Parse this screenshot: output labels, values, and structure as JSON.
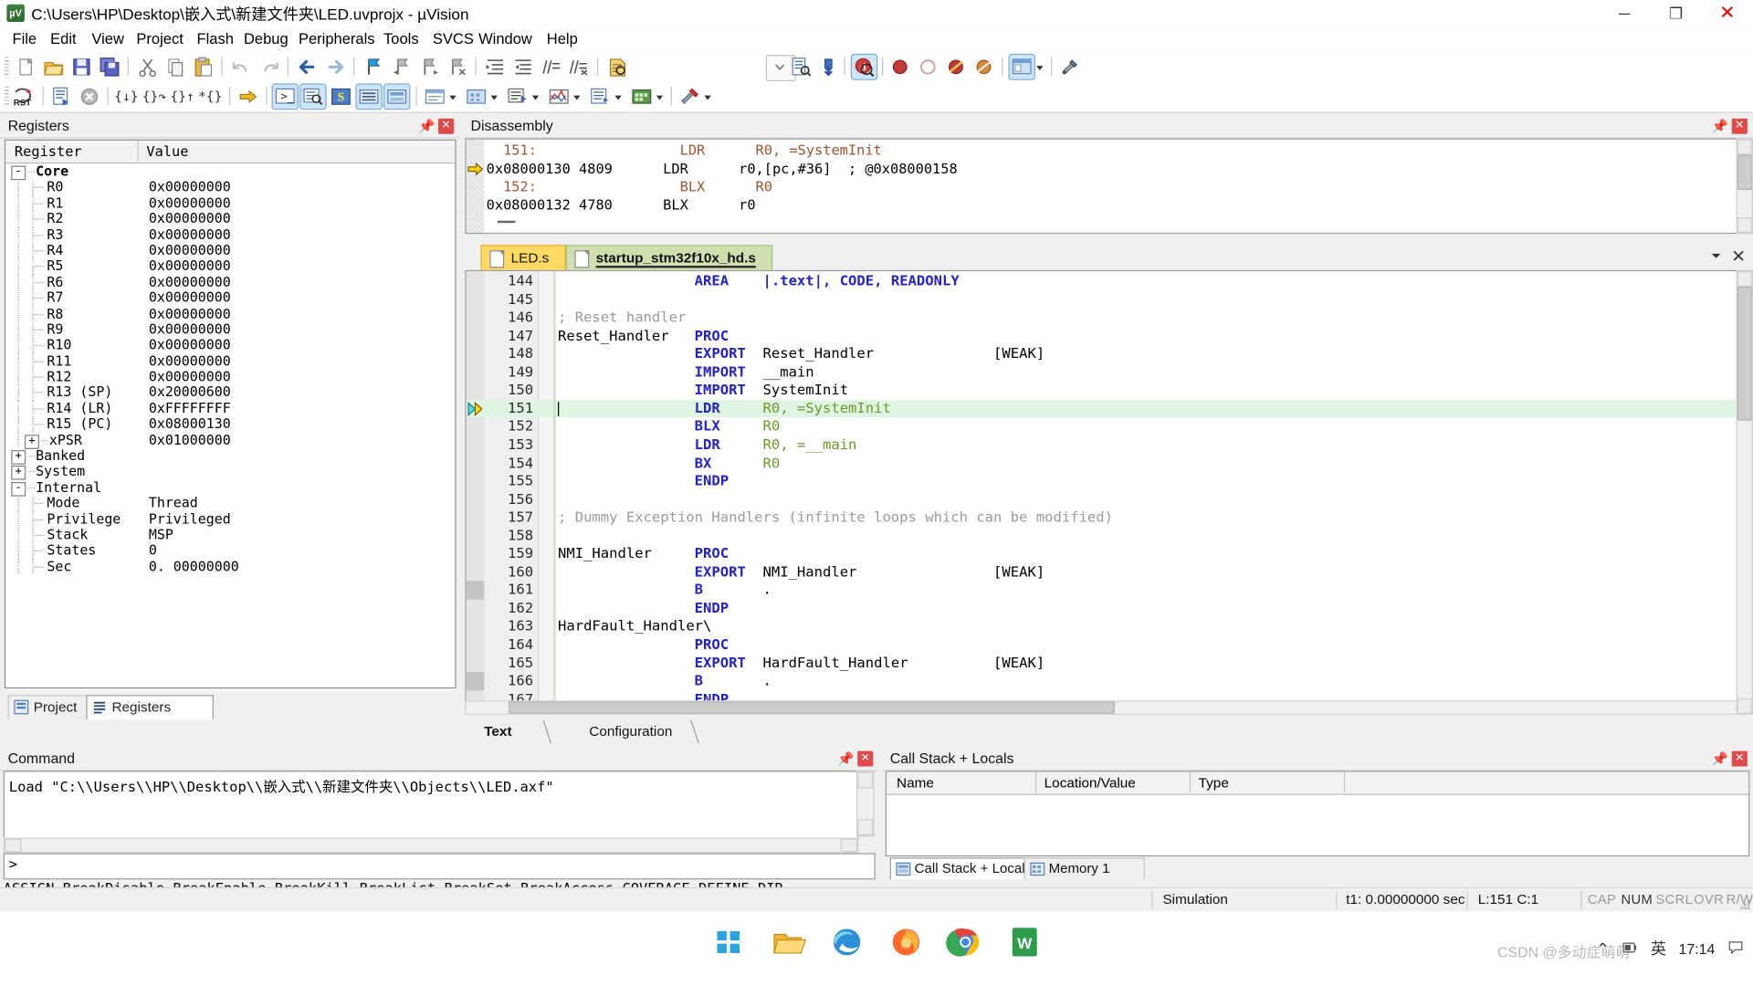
{
  "window": {
    "title": "C:\\Users\\HP\\Desktop\\嵌入式\\新建文件夹\\LED.uvprojx - µVision",
    "app_icon": "uvision-icon",
    "minimize": "─",
    "maximize": "❐",
    "close": "✕"
  },
  "menu": [
    {
      "label": "File"
    },
    {
      "label": "Edit"
    },
    {
      "label": "View"
    },
    {
      "label": "Project"
    },
    {
      "label": "Flash"
    },
    {
      "label": "Debug"
    },
    {
      "label": "Peripherals"
    },
    {
      "label": "Tools"
    },
    {
      "label": "SVCS"
    },
    {
      "label": "Window"
    },
    {
      "label": "Help"
    }
  ],
  "toolbar_row1": [
    {
      "name": "new-file-icon"
    },
    {
      "name": "open-file-icon"
    },
    {
      "name": "save-icon"
    },
    {
      "name": "save-all-icon"
    },
    {
      "name": "cut-icon"
    },
    {
      "name": "copy-icon"
    },
    {
      "name": "paste-icon"
    },
    {
      "name": "undo-icon"
    },
    {
      "name": "redo-icon"
    },
    {
      "name": "back-icon"
    },
    {
      "name": "forward-icon"
    },
    {
      "name": "bookmark-toggle-icon"
    },
    {
      "name": "bookmark-prev-icon"
    },
    {
      "name": "bookmark-next-icon"
    },
    {
      "name": "bookmark-clear-icon"
    },
    {
      "name": "indent-icon"
    },
    {
      "name": "outdent-icon"
    },
    {
      "name": "comment-icon"
    },
    {
      "name": "uncomment-icon"
    },
    {
      "name": "find-in-files-icon"
    },
    {
      "name": "find-combo-dropdown"
    },
    {
      "name": "incremental-find-icon"
    },
    {
      "name": "bookmark-goto-icon"
    },
    {
      "name": "debug-session-icon"
    },
    {
      "name": "insert-breakpoint-icon"
    },
    {
      "name": "disable-breakpoint-icon"
    },
    {
      "name": "kill-all-breakpoints-icon"
    },
    {
      "name": "disable-all-breakpoints-icon"
    },
    {
      "name": "manage-windows-icon"
    },
    {
      "name": "manage-windows-dropdown"
    },
    {
      "name": "configure-tools-icon"
    }
  ],
  "toolbar_row2": [
    {
      "name": "reset-cpu-icon"
    },
    {
      "name": "run-icon"
    },
    {
      "name": "stop-icon"
    },
    {
      "name": "step-icon"
    },
    {
      "name": "step-over-icon"
    },
    {
      "name": "step-out-icon"
    },
    {
      "name": "run-to-cursor-icon"
    },
    {
      "name": "show-next-statement-icon"
    },
    {
      "name": "command-window-icon"
    },
    {
      "name": "disassembly-window-icon"
    },
    {
      "name": "symbols-window-icon"
    },
    {
      "name": "registers-window-icon"
    },
    {
      "name": "call-stack-window-icon"
    },
    {
      "name": "watch-windows-icon"
    },
    {
      "name": "watch-dropdown"
    },
    {
      "name": "memory-windows-icon"
    },
    {
      "name": "memory-dropdown"
    },
    {
      "name": "serial-windows-icon"
    },
    {
      "name": "serial-dropdown"
    },
    {
      "name": "analysis-windows-icon"
    },
    {
      "name": "analysis-dropdown"
    },
    {
      "name": "trace-windows-icon"
    },
    {
      "name": "trace-dropdown"
    },
    {
      "name": "system-viewer-icon"
    },
    {
      "name": "system-viewer-dropdown"
    },
    {
      "name": "toolbox-icon"
    },
    {
      "name": "toolbox-dropdown"
    }
  ],
  "registers_pane": {
    "title": "Registers",
    "pin_icon": "pin-icon",
    "close_icon": "close-icon",
    "columns": [
      "Register",
      "Value"
    ],
    "rows": [
      {
        "indent": 0,
        "toggle": "-",
        "name": "Core",
        "value": "",
        "bold": true
      },
      {
        "indent": 2,
        "toggle": "",
        "name": "R0",
        "value": "0x00000000"
      },
      {
        "indent": 2,
        "toggle": "",
        "name": "R1",
        "value": "0x00000000"
      },
      {
        "indent": 2,
        "toggle": "",
        "name": "R2",
        "value": "0x00000000"
      },
      {
        "indent": 2,
        "toggle": "",
        "name": "R3",
        "value": "0x00000000"
      },
      {
        "indent": 2,
        "toggle": "",
        "name": "R4",
        "value": "0x00000000"
      },
      {
        "indent": 2,
        "toggle": "",
        "name": "R5",
        "value": "0x00000000"
      },
      {
        "indent": 2,
        "toggle": "",
        "name": "R6",
        "value": "0x00000000"
      },
      {
        "indent": 2,
        "toggle": "",
        "name": "R7",
        "value": "0x00000000"
      },
      {
        "indent": 2,
        "toggle": "",
        "name": "R8",
        "value": "0x00000000"
      },
      {
        "indent": 2,
        "toggle": "",
        "name": "R9",
        "value": "0x00000000"
      },
      {
        "indent": 2,
        "toggle": "",
        "name": "R10",
        "value": "0x00000000"
      },
      {
        "indent": 2,
        "toggle": "",
        "name": "R11",
        "value": "0x00000000"
      },
      {
        "indent": 2,
        "toggle": "",
        "name": "R12",
        "value": "0x00000000"
      },
      {
        "indent": 2,
        "toggle": "",
        "name": "R13 (SP)",
        "value": "0x20000600"
      },
      {
        "indent": 2,
        "toggle": "",
        "name": "R14 (LR)",
        "value": "0xFFFFFFFF"
      },
      {
        "indent": 2,
        "toggle": "",
        "name": "R15 (PC)",
        "value": "0x08000130"
      },
      {
        "indent": 1,
        "toggle": "+",
        "name": "xPSR",
        "value": "0x01000000"
      },
      {
        "indent": 0,
        "toggle": "+",
        "name": "Banked",
        "value": ""
      },
      {
        "indent": 0,
        "toggle": "+",
        "name": "System",
        "value": ""
      },
      {
        "indent": 0,
        "toggle": "-",
        "name": "Internal",
        "value": ""
      },
      {
        "indent": 2,
        "toggle": "",
        "name": "Mode",
        "value": "Thread"
      },
      {
        "indent": 2,
        "toggle": "",
        "name": "Privilege",
        "value": "Privileged"
      },
      {
        "indent": 2,
        "toggle": "",
        "name": "Stack",
        "value": "MSP"
      },
      {
        "indent": 2,
        "toggle": "",
        "name": "States",
        "value": "0"
      },
      {
        "indent": 2,
        "toggle": "",
        "name": "Sec",
        "value": "0. 00000000"
      }
    ],
    "bottom_tabs": [
      {
        "label": "Project",
        "icon": "project-icon",
        "active": false
      },
      {
        "label": "Registers",
        "icon": "registers-icon",
        "active": true
      }
    ]
  },
  "disassembly_pane": {
    "title": "Disassembly",
    "pin_icon": "pin-icon",
    "close_icon": "close-icon",
    "lines": [
      {
        "kind": "src",
        "text": "  151:                 LDR      R0, =SystemInit ",
        "pc": false
      },
      {
        "kind": "asm",
        "text": "0x08000130 4809      LDR      r0,[pc,#36]  ; @0x08000158",
        "pc": true
      },
      {
        "kind": "src",
        "text": "  152:                 BLX      R0 ",
        "pc": false
      },
      {
        "kind": "asm",
        "text": "0x08000132 4780      BLX      r0",
        "pc": false
      }
    ]
  },
  "editor": {
    "tabs": [
      {
        "label": "LED.s",
        "active": false,
        "icon": "file-icon"
      },
      {
        "label": "startup_stm32f10x_hd.s",
        "active": true,
        "icon": "file-icon"
      }
    ],
    "bottom_tabs": [
      {
        "label": "Text Editor",
        "active": true
      },
      {
        "label": "Configuration Wizard",
        "active": false
      }
    ],
    "lines": [
      {
        "num": "144",
        "hl": false,
        "marker": "",
        "spans": [
          {
            "t": "                ",
            "c": "plain"
          },
          {
            "t": "AREA",
            "c": "kw"
          },
          {
            "t": "    ",
            "c": "plain"
          },
          {
            "t": "|.text|,",
            "c": "kw"
          },
          {
            "t": " ",
            "c": "plain"
          },
          {
            "t": "CODE,",
            "c": "kw"
          },
          {
            "t": " ",
            "c": "plain"
          },
          {
            "t": "READONLY",
            "c": "kw"
          }
        ]
      },
      {
        "num": "145",
        "hl": false,
        "marker": "",
        "spans": []
      },
      {
        "num": "146",
        "hl": false,
        "marker": "",
        "spans": [
          {
            "t": "; Reset handler",
            "c": "cmt"
          }
        ]
      },
      {
        "num": "147",
        "hl": false,
        "marker": "",
        "spans": [
          {
            "t": "Reset_Handler   ",
            "c": "plain"
          },
          {
            "t": "PROC",
            "c": "kw"
          }
        ]
      },
      {
        "num": "148",
        "hl": false,
        "marker": "",
        "spans": [
          {
            "t": "                ",
            "c": "plain"
          },
          {
            "t": "EXPORT",
            "c": "kw"
          },
          {
            "t": "  Reset_Handler              [WEAK]",
            "c": "plain"
          }
        ]
      },
      {
        "num": "149",
        "hl": false,
        "marker": "",
        "spans": [
          {
            "t": "                ",
            "c": "plain"
          },
          {
            "t": "IMPORT",
            "c": "kw"
          },
          {
            "t": "  __main",
            "c": "plain"
          }
        ]
      },
      {
        "num": "150",
        "hl": false,
        "marker": "",
        "spans": [
          {
            "t": "                ",
            "c": "plain"
          },
          {
            "t": "IMPORT",
            "c": "kw"
          },
          {
            "t": "  SystemInit",
            "c": "plain"
          }
        ]
      },
      {
        "num": "151",
        "hl": true,
        "marker": "pc-arrows",
        "spans": [
          {
            "t": "                ",
            "c": "plain"
          },
          {
            "t": "LDR",
            "c": "kw"
          },
          {
            "t": "     ",
            "c": "plain"
          },
          {
            "t": "R0, =SystemInit",
            "c": "reg6"
          }
        ]
      },
      {
        "num": "152",
        "hl": false,
        "marker": "",
        "spans": [
          {
            "t": "                ",
            "c": "plain"
          },
          {
            "t": "BLX",
            "c": "kw"
          },
          {
            "t": "     ",
            "c": "plain"
          },
          {
            "t": "R0",
            "c": "reg6"
          }
        ]
      },
      {
        "num": "153",
        "hl": false,
        "marker": "",
        "spans": [
          {
            "t": "                ",
            "c": "plain"
          },
          {
            "t": "LDR",
            "c": "kw"
          },
          {
            "t": "     ",
            "c": "plain"
          },
          {
            "t": "R0, =__main",
            "c": "reg6"
          }
        ]
      },
      {
        "num": "154",
        "hl": false,
        "marker": "",
        "spans": [
          {
            "t": "                ",
            "c": "plain"
          },
          {
            "t": "BX",
            "c": "kw"
          },
          {
            "t": "      ",
            "c": "plain"
          },
          {
            "t": "R0",
            "c": "reg6"
          }
        ]
      },
      {
        "num": "155",
        "hl": false,
        "marker": "",
        "spans": [
          {
            "t": "                ",
            "c": "plain"
          },
          {
            "t": "ENDP",
            "c": "kw"
          }
        ]
      },
      {
        "num": "156",
        "hl": false,
        "marker": "",
        "spans": []
      },
      {
        "num": "157",
        "hl": false,
        "marker": "",
        "spans": [
          {
            "t": "; Dummy Exception Handlers (infinite loops which can be modified)",
            "c": "cmt"
          }
        ]
      },
      {
        "num": "158",
        "hl": false,
        "marker": "",
        "spans": []
      },
      {
        "num": "159",
        "hl": false,
        "marker": "",
        "spans": [
          {
            "t": "NMI_Handler     ",
            "c": "plain"
          },
          {
            "t": "PROC",
            "c": "kw"
          }
        ]
      },
      {
        "num": "160",
        "hl": false,
        "marker": "",
        "spans": [
          {
            "t": "                ",
            "c": "plain"
          },
          {
            "t": "EXPORT",
            "c": "kw"
          },
          {
            "t": "  NMI_Handler                [WEAK]",
            "c": "plain"
          }
        ]
      },
      {
        "num": "161",
        "hl": false,
        "marker": "bar",
        "spans": [
          {
            "t": "                ",
            "c": "plain"
          },
          {
            "t": "B",
            "c": "kw"
          },
          {
            "t": "       .",
            "c": "plain"
          }
        ]
      },
      {
        "num": "162",
        "hl": false,
        "marker": "",
        "spans": [
          {
            "t": "                ",
            "c": "plain"
          },
          {
            "t": "ENDP",
            "c": "kw"
          }
        ]
      },
      {
        "num": "163",
        "hl": false,
        "marker": "",
        "spans": [
          {
            "t": "HardFault_Handler\\",
            "c": "plain"
          }
        ]
      },
      {
        "num": "164",
        "hl": false,
        "marker": "",
        "spans": [
          {
            "t": "                ",
            "c": "plain"
          },
          {
            "t": "PROC",
            "c": "kw"
          }
        ]
      },
      {
        "num": "165",
        "hl": false,
        "marker": "",
        "spans": [
          {
            "t": "                ",
            "c": "plain"
          },
          {
            "t": "EXPORT",
            "c": "kw"
          },
          {
            "t": "  HardFault_Handler          [WEAK]",
            "c": "plain"
          }
        ]
      },
      {
        "num": "166",
        "hl": false,
        "marker": "bar",
        "spans": [
          {
            "t": "                ",
            "c": "plain"
          },
          {
            "t": "B",
            "c": "kw"
          },
          {
            "t": "       .",
            "c": "plain"
          }
        ]
      },
      {
        "num": "167",
        "hl": false,
        "marker": "",
        "spans": [
          {
            "t": "                ",
            "c": "plain"
          },
          {
            "t": "ENDP",
            "c": "kw"
          }
        ]
      }
    ]
  },
  "command_pane": {
    "title": "Command",
    "pin_icon": "pin-icon",
    "close_icon": "close-icon",
    "output": "Load \"C:\\\\Users\\\\HP\\\\Desktop\\\\嵌入式\\\\新建文件夹\\\\Objects\\\\LED.axf\"",
    "prompt": ">",
    "input_value": "",
    "help_line": "ASSIGN BreakDisable BreakEnable BreakKill BreakList BreakSet BreakAccess COVERAGE DEFINE DIR"
  },
  "callstack_pane": {
    "title": "Call Stack + Locals",
    "pin_icon": "pin-icon",
    "close_icon": "close-icon",
    "columns": [
      "Name",
      "Location/Value",
      "Type"
    ],
    "rows": [],
    "tabs": [
      {
        "label": "Call Stack + Locals",
        "icon": "call-stack-icon",
        "active": true
      },
      {
        "label": "Memory 1",
        "icon": "memory-icon",
        "active": false
      }
    ]
  },
  "statusbar": {
    "simulation": "Simulation",
    "time": "t1: 0.00000000 sec",
    "position": "L:151 C:1",
    "indicators": [
      "CAP",
      "NUM",
      "SCRL",
      "OVR",
      "R/W"
    ]
  },
  "taskbar": {
    "items": [
      {
        "name": "start-button"
      },
      {
        "name": "file-explorer-button"
      },
      {
        "name": "edge-browser-button"
      },
      {
        "name": "firefox-browser-button"
      },
      {
        "name": "chrome-browser-button"
      },
      {
        "name": "wps-office-button"
      }
    ],
    "tray": {
      "chevron": "⌃",
      "ime_label": "英",
      "time": "17:14",
      "date": "",
      "watermark": "CSDN @多动症萌萌"
    }
  }
}
